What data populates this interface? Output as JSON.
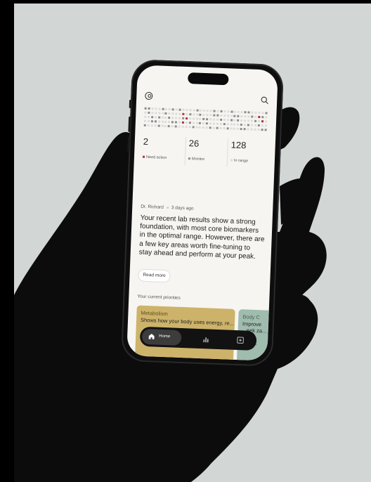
{
  "scene": {
    "background": "#d2d6d5",
    "hand_color": "#0c0c0c"
  },
  "header": {
    "profile_icon": "profile-icon",
    "search_icon": "search-icon"
  },
  "biomarker_grid": {
    "colors": {
      "action": "#b0323a",
      "monitor": "#8d8d8d",
      "in_range": "#dcdcdc"
    }
  },
  "stats": [
    {
      "value": "2",
      "label": "Need action",
      "color": "#b0323a"
    },
    {
      "value": "26",
      "label": "Monitor",
      "color": "#8d8d8d"
    },
    {
      "value": "128",
      "label": "In range",
      "color": "#dcdcdc"
    }
  ],
  "note": {
    "author": "Dr. Richard",
    "time": "3 days ago",
    "body": "Your recent lab results show a strong foundation, with most core biomarkers in the optimal range. However, there are a few key areas worth fine-tuning to stay ahead and perform at your peak.",
    "read_more": "Read more"
  },
  "priorities": {
    "title": "Your current priorities",
    "cards": [
      {
        "title": "Metabolism",
        "description": "Shows how your body uses energy, re...",
        "color": "#cdb36a",
        "title_color": "#5e4f1c"
      },
      {
        "title": "Body C",
        "description": "Improve ...eek za... ever... nsist...",
        "color": "#9fbcae",
        "title_color": "#4a5f56"
      }
    ]
  },
  "tabbar": {
    "home_label": "Home",
    "home_icon": "home-icon",
    "stats_icon": "bar-chart-icon",
    "plan_icon": "plus-square-icon"
  }
}
